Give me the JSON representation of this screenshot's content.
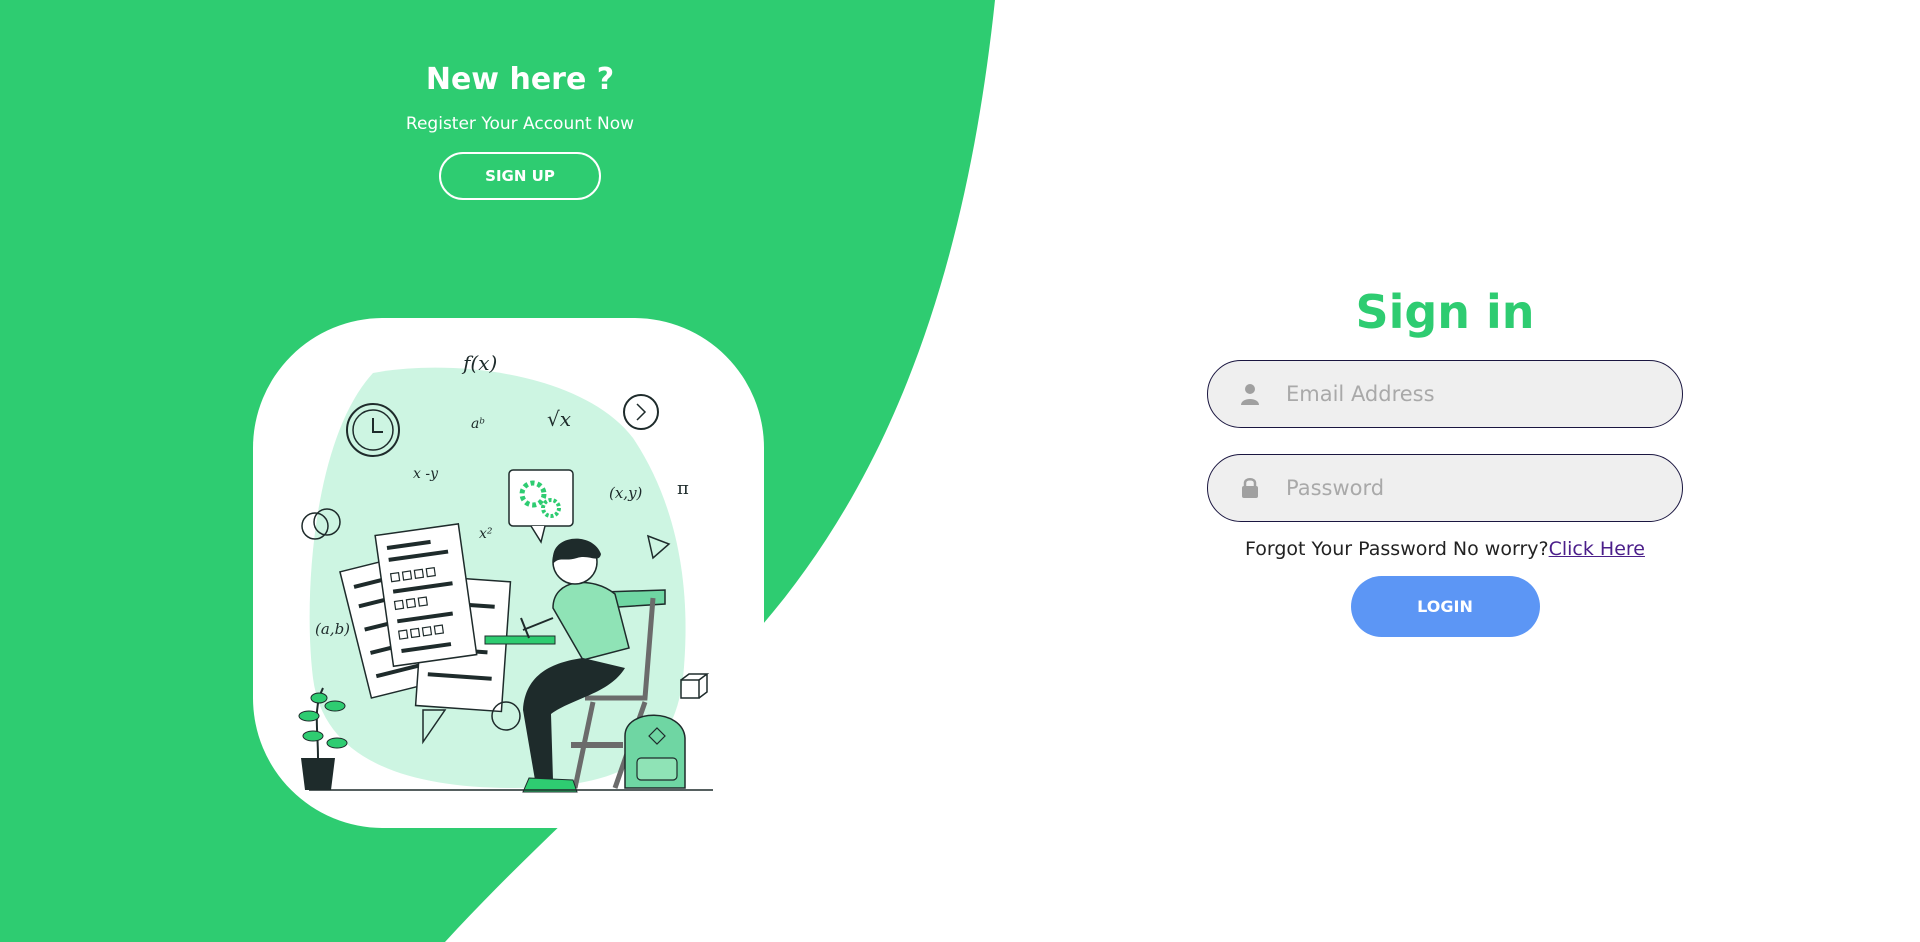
{
  "colors": {
    "brand_green": "#2ecc71",
    "light_green": "#cdf5e2",
    "button_blue": "#5c96f5",
    "field_bg": "#efefef",
    "field_border": "#1a1640",
    "link_purple": "#4b1e8a"
  },
  "left_panel": {
    "title": "New here ?",
    "subtitle": "Register Your Account Now",
    "signup_label": "SIGN UP"
  },
  "illustration": {
    "icon": "student-exam-illustration",
    "math_labels": [
      "f(x)",
      "aᵇ",
      "√x",
      "x -y",
      "x²",
      "(x,y)",
      "π",
      "(a,b)"
    ]
  },
  "signin": {
    "title": "Sign in",
    "email_placeholder": "Email Address",
    "email_icon": "user-icon",
    "password_placeholder": "Password",
    "password_icon": "lock-icon",
    "forgot_text": "Forgot Your Password No worry?",
    "forgot_link": "Click Here",
    "login_label": "LOGIN"
  }
}
